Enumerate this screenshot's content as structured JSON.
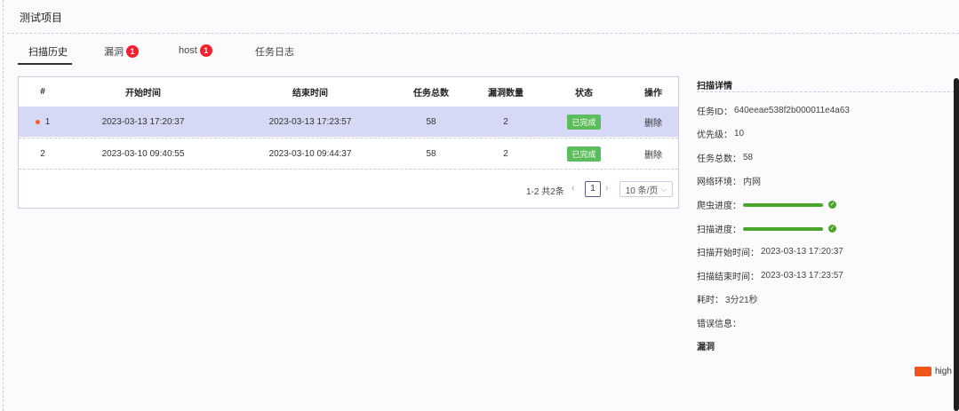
{
  "app": {
    "title": "测试项目"
  },
  "tabs": [
    {
      "label": "扫描历史",
      "badge": ""
    },
    {
      "label": "漏洞",
      "badge": "1"
    },
    {
      "label": "host",
      "badge": "1"
    },
    {
      "label": "任务日志",
      "badge": ""
    }
  ],
  "table": {
    "columns": [
      "#",
      "开始时间",
      "结束时间",
      "任务总数",
      "漏洞数量",
      "状态",
      "操作"
    ],
    "rows": [
      {
        "idx": "1",
        "start": "2023-03-13 17:20:37",
        "end": "2023-03-13 17:23:57",
        "total": "58",
        "vulns": "2",
        "status": "已完成",
        "action": "删除"
      },
      {
        "idx": "2",
        "start": "2023-03-10 09:40:55",
        "end": "2023-03-10 09:44:37",
        "total": "58",
        "vulns": "2",
        "status": "已完成",
        "action": "删除"
      }
    ]
  },
  "pagination": {
    "total_text": "1-2 共2条",
    "current_page": "1",
    "page_size": "10 条/页"
  },
  "detail": {
    "title": "扫描详情",
    "task_id_label": "任务ID：",
    "task_id": "640eeae538f2b000011e4a63",
    "priority_label": "优先级：",
    "priority": "10",
    "total_label": "任务总数：",
    "total": "58",
    "network_label": "网络环境：",
    "network": "内网",
    "crawl_label": "爬虫进度：",
    "crawl_progress": 1.0,
    "scan_label": "扫描进度：",
    "scan_progress": 1.0,
    "scan_start_label": "扫描开始时间：",
    "scan_start": "2023-03-13 17:20:37",
    "scan_end_label": "扫描结束时间：",
    "scan_end": "2023-03-13 17:23:57",
    "duration_label": "耗时：",
    "duration": "3分21秒",
    "error_label": "错误信息：",
    "error": "",
    "vuln_section": "漏洞"
  },
  "legend": {
    "label": "high",
    "color": "#f05519"
  },
  "colors": {
    "status_done": "#5cbd5c",
    "badge": "#f5222d",
    "progress": "#4aa52b",
    "selected_row": "#d6d9f5"
  }
}
